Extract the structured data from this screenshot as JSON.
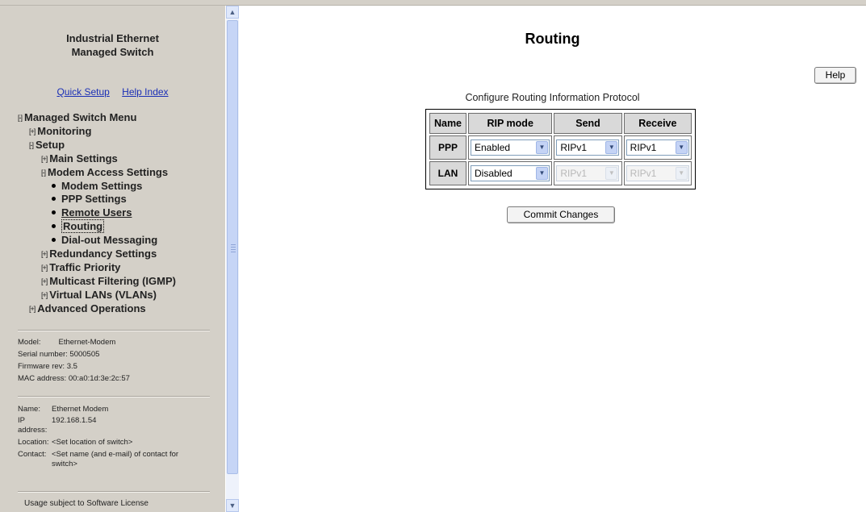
{
  "sidebar": {
    "title_line1": "Industrial Ethernet",
    "title_line2": "Managed Switch",
    "links": {
      "quick_setup": "Quick Setup",
      "help_index": "Help Index"
    },
    "menu": {
      "root": {
        "toggle": "[-]",
        "label": "Managed Switch Menu"
      },
      "monitoring": {
        "toggle": "[+]",
        "label": "Monitoring"
      },
      "setup": {
        "toggle": "[-]",
        "label": "Setup"
      },
      "main_settings": {
        "toggle": "[+]",
        "label": "Main Settings"
      },
      "modem_access": {
        "toggle": "[-]",
        "label": "Modem Access Settings"
      },
      "modem_settings": "Modem Settings",
      "ppp_settings": "PPP Settings",
      "remote_users": "Remote Users",
      "routing": "Routing",
      "dialout": "Dial-out Messaging",
      "redundancy": {
        "toggle": "[+]",
        "label": "Redundancy Settings"
      },
      "traffic": {
        "toggle": "[+]",
        "label": "Traffic Priority"
      },
      "multicast": {
        "toggle": "[+]",
        "label": "Multicast Filtering (IGMP)"
      },
      "vlans": {
        "toggle": "[+]",
        "label": "Virtual LANs (VLANs)"
      },
      "advanced": {
        "toggle": "[+]",
        "label": "Advanced Operations"
      }
    },
    "device": {
      "model_label": "Model:",
      "model": "Ethernet-Modem",
      "serial_label": "Serial number:",
      "serial": "5000505",
      "firmware_label": "Firmware rev:",
      "firmware": "3.5",
      "mac_label": "MAC address:",
      "mac": "00:a0:1d:3e:2c:57"
    },
    "identity": {
      "name_label": "Name:",
      "name": "Ethernet Modem",
      "ip_label_1": "IP",
      "ip_label_2": "address:",
      "ip": "192.168.1.54",
      "location_label": "Location:",
      "location": "<Set location of switch>",
      "contact_label": "Contact:",
      "contact": "<Set name (and e-mail) of contact for switch>"
    },
    "usage": "Usage subject to Software License"
  },
  "main": {
    "title": "Routing",
    "help_label": "Help",
    "caption": "Configure Routing Information Protocol",
    "headers": [
      "Name",
      "RIP mode",
      "Send",
      "Receive"
    ],
    "rows": [
      {
        "name": "PPP",
        "rip_mode": "Enabled",
        "send": "RIPv1",
        "receive": "RIPv1"
      },
      {
        "name": "LAN",
        "rip_mode": "Disabled",
        "send": "RIPv1",
        "receive": "RIPv1"
      }
    ],
    "commit_label": "Commit Changes"
  }
}
